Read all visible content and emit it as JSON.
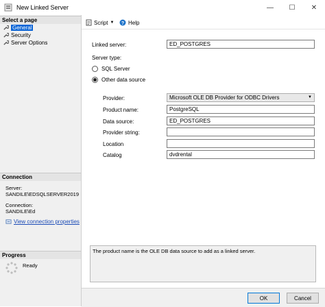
{
  "window": {
    "title": "New Linked Server",
    "minimize": "—",
    "maximize": "☐",
    "close": "✕"
  },
  "left": {
    "select_page_header": "Select a page",
    "pages": [
      {
        "label": "General"
      },
      {
        "label": "Security"
      },
      {
        "label": "Server Options"
      }
    ],
    "connection_header": "Connection",
    "server_label": "Server:",
    "server_value": "SANDILE\\EDSQLSERVER2019",
    "connection_label": "Connection:",
    "connection_value": "SANDILE\\Ed",
    "view_connection_link": "View connection properties",
    "progress_header": "Progress",
    "progress_status": "Ready"
  },
  "toolbar": {
    "script_label": "Script",
    "help_label": "Help"
  },
  "form": {
    "linked_server_label": "Linked server:",
    "linked_server_value": "ED_POSTGRES",
    "server_type_label": "Server type:",
    "sql_server_label": "SQL Server",
    "other_data_source_label": "Other data source",
    "selected_server_type": "Other data source",
    "provider_label": "Provider:",
    "provider_value": "Microsoft OLE DB Provider for ODBC Drivers",
    "product_name_label": "Product name:",
    "product_name_value": "PostgreSQL",
    "data_source_label": "Data source:",
    "data_source_value": "ED_POSTGRES",
    "provider_string_label": "Provider string:",
    "provider_string_value": "",
    "location_label": "Location",
    "location_value": "",
    "catalog_label": "Catalog",
    "catalog_value": "dvdrental"
  },
  "description": "The product name is the OLE DB data source to add as a linked server.",
  "buttons": {
    "ok": "OK",
    "cancel": "Cancel"
  }
}
